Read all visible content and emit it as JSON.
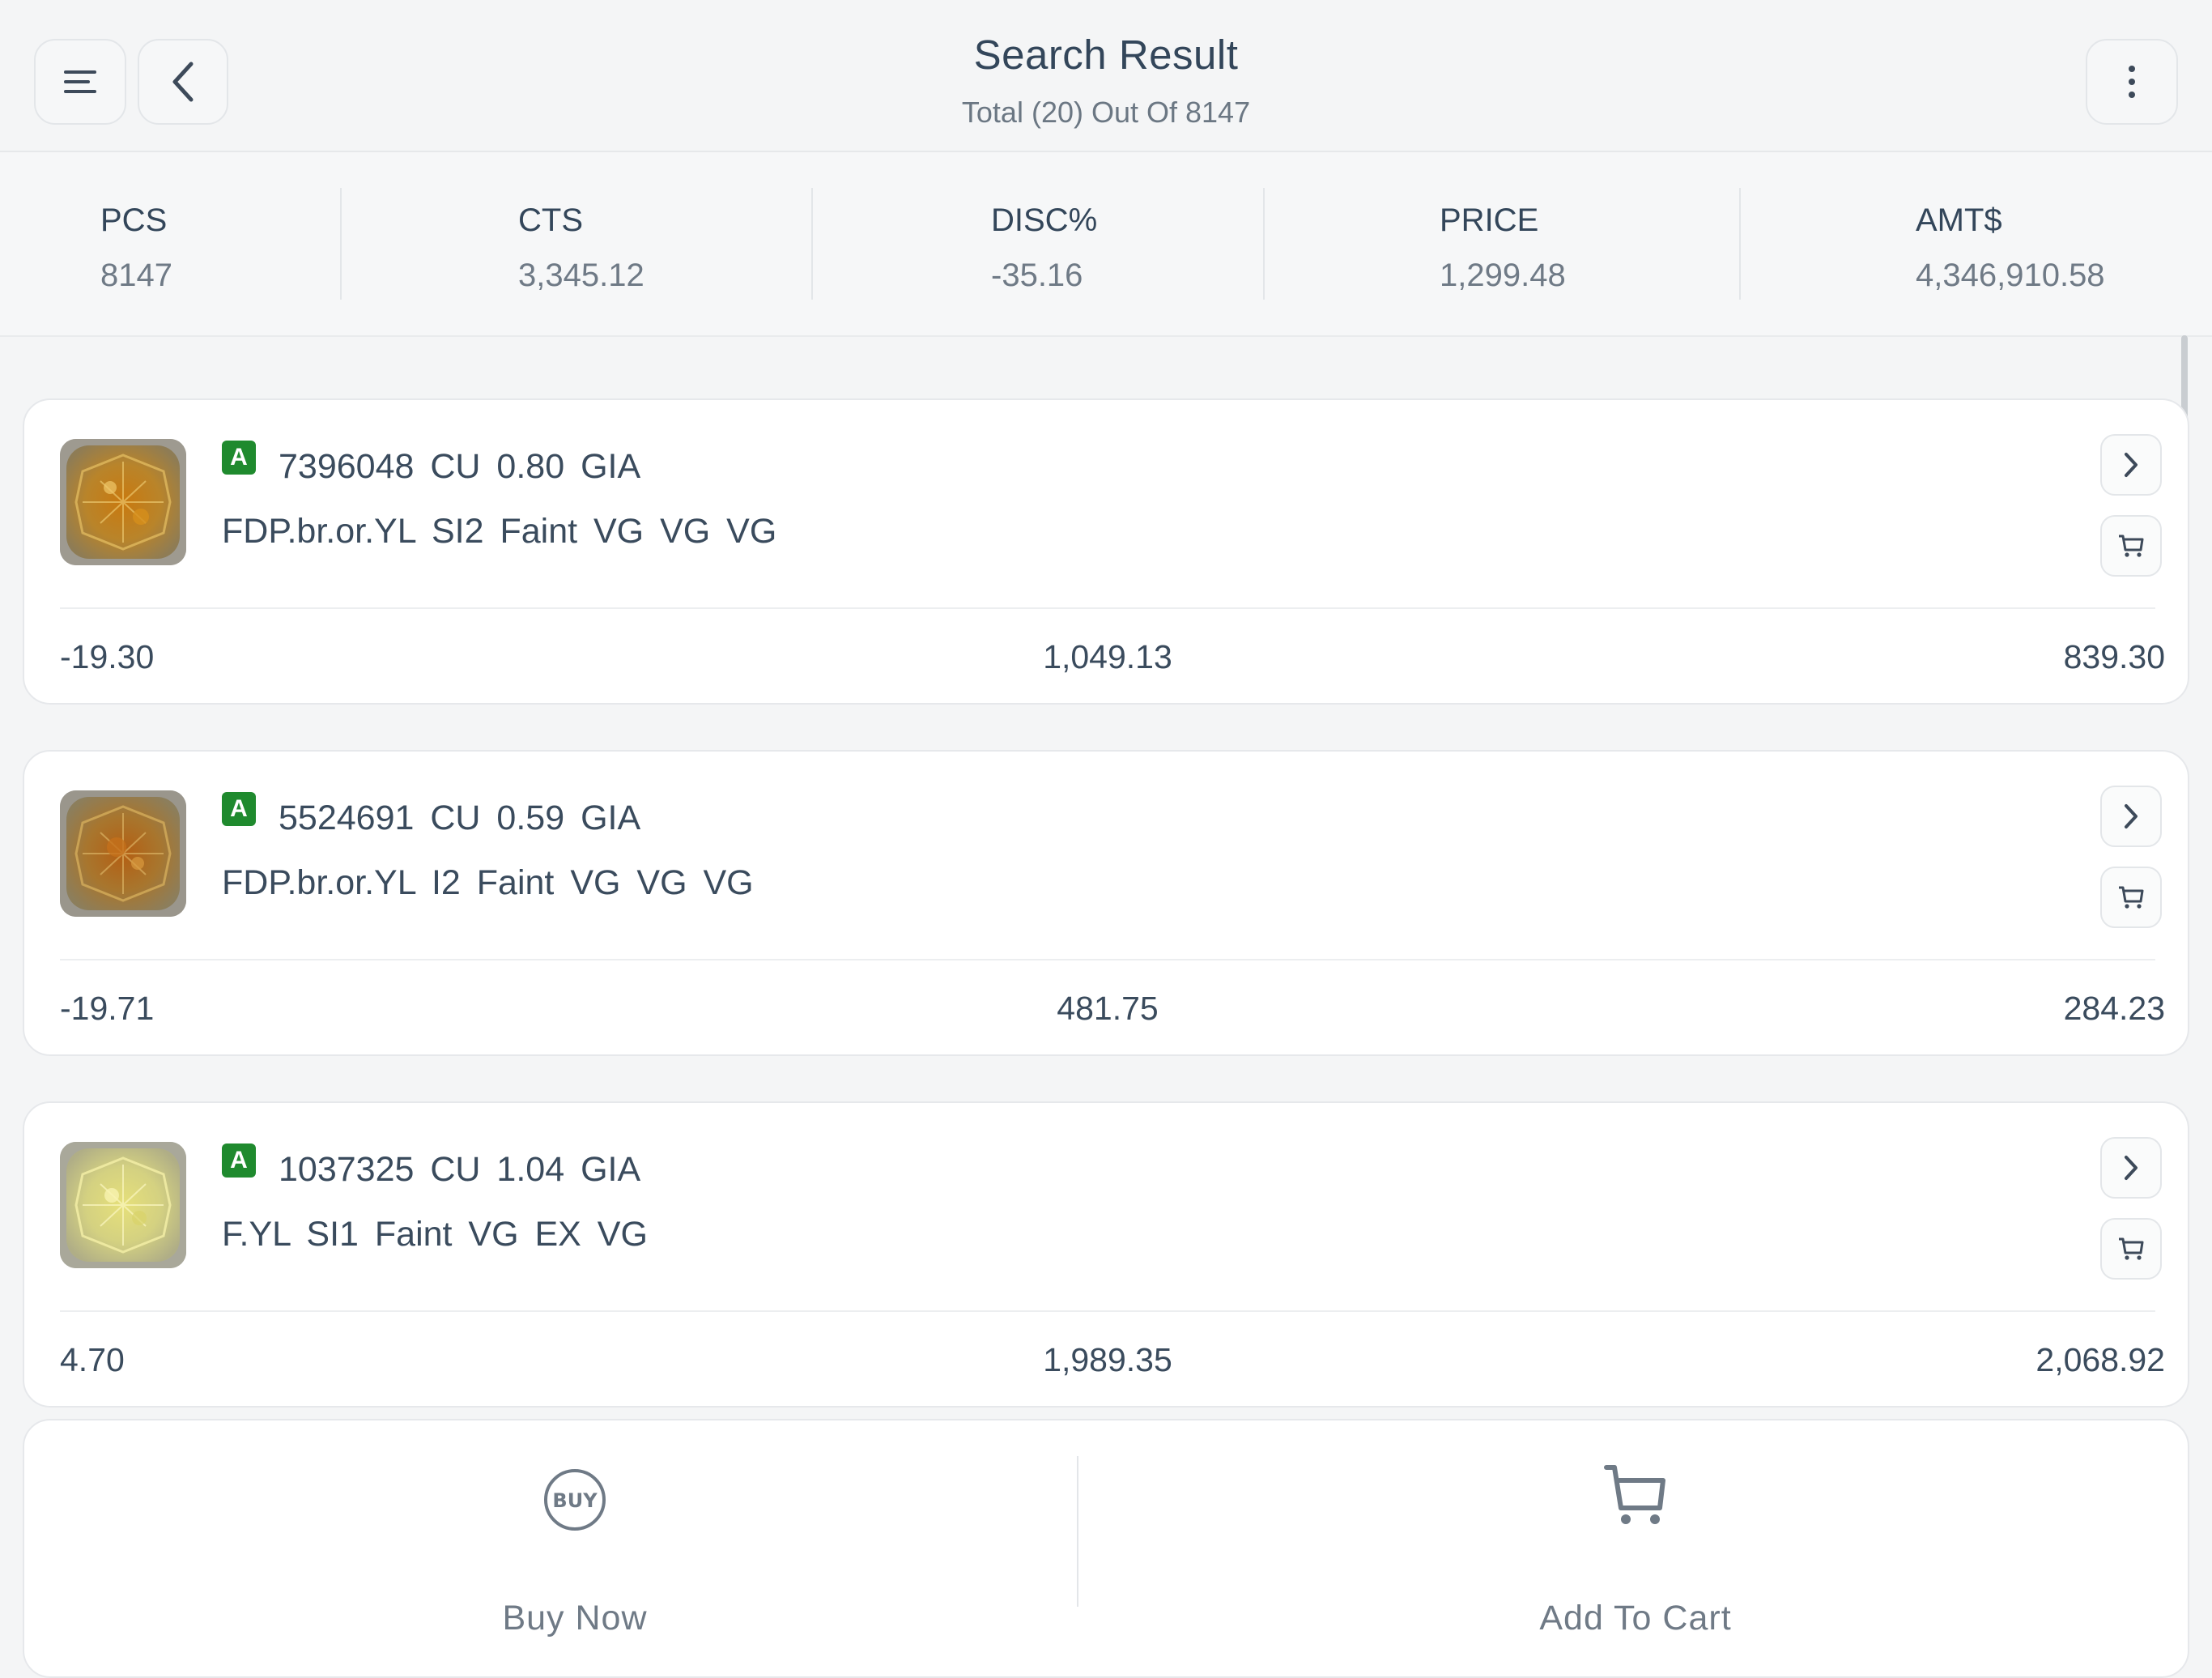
{
  "header": {
    "title": "Search Result",
    "subtitle": "Total (20) Out Of 8147",
    "icons": {
      "menu": "menu-icon",
      "back": "chevron-left-icon",
      "more": "more-vertical-icon"
    }
  },
  "summary": [
    {
      "label": "PCS",
      "value": "8147"
    },
    {
      "label": "CTS",
      "value": "3,345.12"
    },
    {
      "label": "DISC%",
      "value": "-35.16"
    },
    {
      "label": "PRICE",
      "value": "1,299.48"
    },
    {
      "label": "AMT$",
      "value": "4,346,910.58"
    }
  ],
  "results": [
    {
      "badge": "A",
      "stone_id": "7396048",
      "shape": "CU",
      "carat": "0.80",
      "lab": "GIA",
      "details": "FDP.br.or.YL SI2 Faint VG VG VG",
      "disc": "-19.30",
      "price": "1,049.13",
      "amount": "839.30",
      "image_tone": "orange-yellow"
    },
    {
      "badge": "A",
      "stone_id": "5524691",
      "shape": "CU",
      "carat": "0.59",
      "lab": "GIA",
      "details": "FDP.br.or.YL I2 Faint VG VG VG",
      "disc": "-19.71",
      "price": "481.75",
      "amount": "284.23",
      "image_tone": "brown-orange"
    },
    {
      "badge": "A",
      "stone_id": "1037325",
      "shape": "CU",
      "carat": "1.04",
      "lab": "GIA",
      "details": "F.YL SI1 Faint VG EX VG",
      "disc": "4.70",
      "price": "1,989.35",
      "amount": "2,068.92",
      "image_tone": "light-yellow"
    }
  ],
  "bottom_bar": {
    "buy_label": "Buy Now",
    "buy_icon": "buy-icon",
    "buy_icon_text": "BUY",
    "cart_label": "Add To Cart",
    "cart_icon": "cart-icon"
  },
  "colors": {
    "accent_badge": "#1f8a2e",
    "text_primary": "#3a4b5d",
    "text_muted": "#6f7a86",
    "background": "#f4f5f6"
  }
}
